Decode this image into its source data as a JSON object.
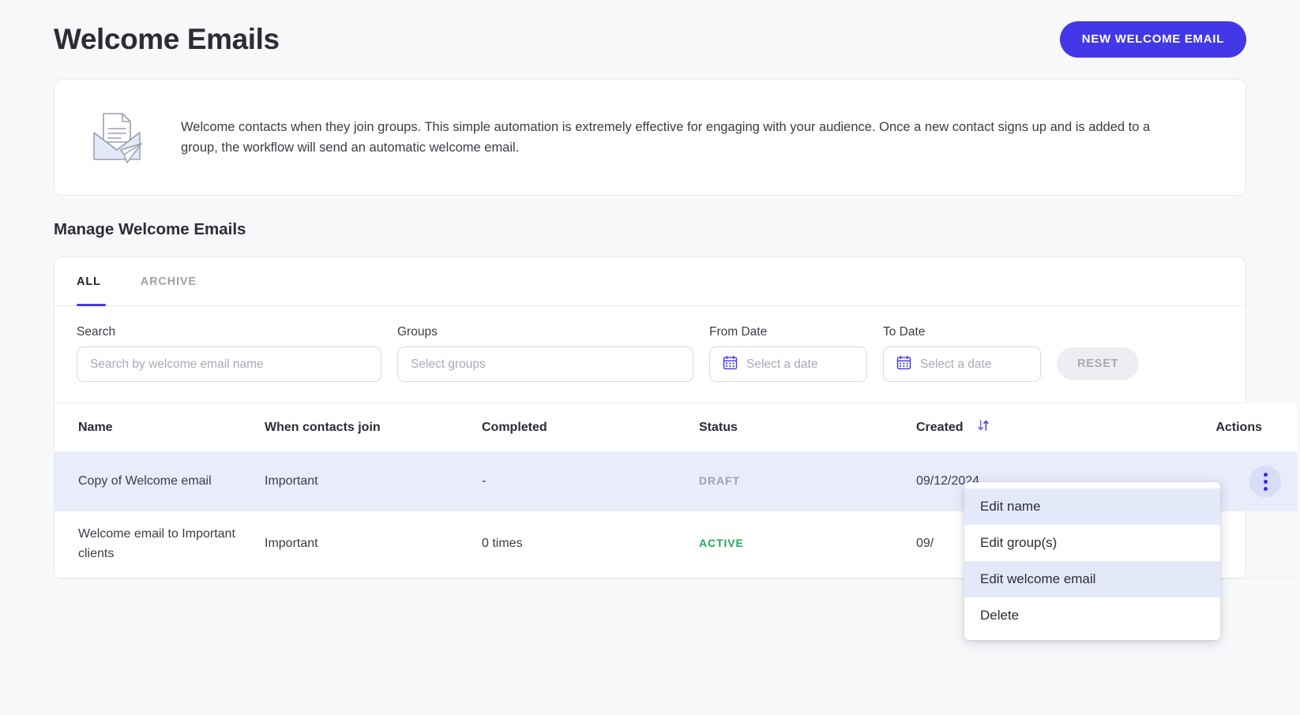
{
  "header": {
    "title": "Welcome Emails",
    "new_button_label": "NEW WELCOME EMAIL"
  },
  "info_card": {
    "icon": "envelope-document-icon",
    "text": "Welcome contacts when they join groups. This simple automation is extremely effective for engaging with your audience. Once a new contact signs up and is added to a group, the workflow will send an automatic welcome email."
  },
  "section": {
    "title": "Manage Welcome Emails"
  },
  "tabs": [
    {
      "label": "ALL",
      "active": true
    },
    {
      "label": "ARCHIVE",
      "active": false
    }
  ],
  "filters": {
    "search": {
      "label": "Search",
      "placeholder": "Search by welcome email name",
      "value": ""
    },
    "groups": {
      "label": "Groups",
      "placeholder": "Select groups",
      "value": ""
    },
    "from_date": {
      "label": "From Date",
      "placeholder": "Select a date",
      "value": "",
      "icon": "calendar-icon"
    },
    "to_date": {
      "label": "To Date",
      "placeholder": "Select a date",
      "value": "",
      "icon": "calendar-icon"
    },
    "reset_label": "RESET"
  },
  "table": {
    "columns": [
      "Name",
      "When contacts join",
      "Completed",
      "Status",
      "Created",
      "Actions"
    ],
    "sort_column": "Created",
    "sort_icon": "sort-updown-icon",
    "rows": [
      {
        "name": "Copy of Welcome email",
        "when": "Important",
        "completed": "-",
        "status": "DRAFT",
        "status_kind": "draft",
        "created": "09/12/2024",
        "selected": true
      },
      {
        "name": "Welcome email to Important clients",
        "when": "Important",
        "completed": "0 times",
        "status": "ACTIVE",
        "status_kind": "active",
        "created": "09/",
        "selected": false
      }
    ]
  },
  "action_menu": {
    "items": [
      {
        "label": "Edit name",
        "highlighted": true
      },
      {
        "label": "Edit group(s)",
        "highlighted": false
      },
      {
        "label": "Edit welcome email",
        "highlighted": true
      },
      {
        "label": "Delete",
        "highlighted": false
      }
    ]
  },
  "colors": {
    "accent": "#4338e8",
    "active_status": "#22a95c",
    "draft_status": "#9ea2ad",
    "row_selected": "#e8ecfb"
  }
}
